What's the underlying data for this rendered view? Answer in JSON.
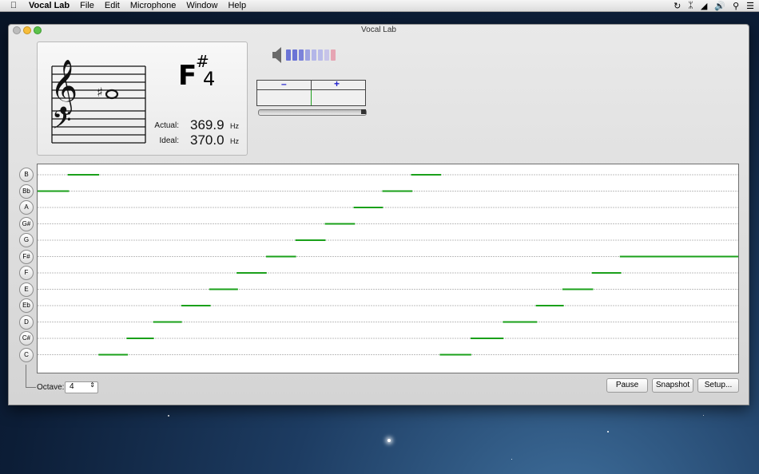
{
  "menubar": {
    "app_name": "Vocal Lab",
    "menus": [
      "File",
      "Edit",
      "Microphone",
      "Window",
      "Help"
    ]
  },
  "window": {
    "title": "Vocal Lab"
  },
  "note_panel": {
    "note_letter": "F",
    "accidental": "#",
    "octave": "4",
    "actual_label": "Actual:",
    "actual_value": "369.9",
    "ideal_label": "Ideal:",
    "ideal_value": "370.0",
    "unit": "Hz"
  },
  "tuner": {
    "minus_label": "–",
    "plus_label": "+"
  },
  "volume": {
    "colors": [
      "#6b74d6",
      "#6b74d6",
      "#7b82da",
      "#9ea3e2",
      "#b3b6e8",
      "#b9bbe9",
      "#c7c4e9",
      "#e6a5b3"
    ]
  },
  "note_buttons": [
    "B",
    "Bb",
    "A",
    "G#",
    "G",
    "F#",
    "F",
    "E",
    "Eb",
    "D",
    "C#",
    "C"
  ],
  "pitch_trace": [
    {
      "note": "Bb",
      "x0": 0.0,
      "x1": 0.045
    },
    {
      "note": "B",
      "x0": 0.043,
      "x1": 0.088
    },
    {
      "note": "C",
      "x0": 0.087,
      "x1": 0.129
    },
    {
      "note": "C#",
      "x0": 0.127,
      "x1": 0.166
    },
    {
      "note": "D",
      "x0": 0.165,
      "x1": 0.206
    },
    {
      "note": "Eb",
      "x0": 0.205,
      "x1": 0.247
    },
    {
      "note": "E",
      "x0": 0.245,
      "x1": 0.286
    },
    {
      "note": "F",
      "x0": 0.284,
      "x1": 0.327
    },
    {
      "note": "F#",
      "x0": 0.326,
      "x1": 0.369
    },
    {
      "note": "G",
      "x0": 0.368,
      "x1": 0.411
    },
    {
      "note": "G#",
      "x0": 0.41,
      "x1": 0.453
    },
    {
      "note": "A",
      "x0": 0.451,
      "x1": 0.493
    },
    {
      "note": "Bb",
      "x0": 0.492,
      "x1": 0.535
    },
    {
      "note": "B",
      "x0": 0.533,
      "x1": 0.576
    },
    {
      "note": "C",
      "x0": 0.574,
      "x1": 0.619
    },
    {
      "note": "C#",
      "x0": 0.618,
      "x1": 0.665
    },
    {
      "note": "D",
      "x0": 0.664,
      "x1": 0.713
    },
    {
      "note": "Eb",
      "x0": 0.711,
      "x1": 0.751
    },
    {
      "note": "E",
      "x0": 0.749,
      "x1": 0.793
    },
    {
      "note": "F",
      "x0": 0.791,
      "x1": 0.833
    },
    {
      "note": "F#",
      "x0": 0.831,
      "x1": 1.0
    }
  ],
  "octave_control": {
    "label": "Octave:",
    "value": "4"
  },
  "buttons": {
    "pause": "Pause",
    "snapshot": "Snapshot",
    "setup": "Setup..."
  }
}
